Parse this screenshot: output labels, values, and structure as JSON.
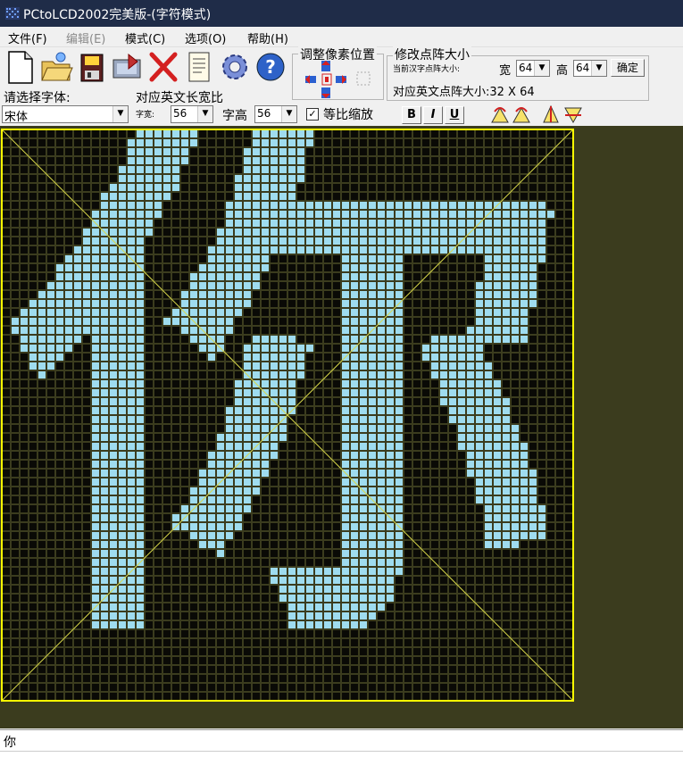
{
  "window": {
    "title": "PCtoLCD2002完美版-(字符模式)"
  },
  "menu": [
    {
      "label": "文件(F)",
      "enabled": true
    },
    {
      "label": "编辑(E)",
      "enabled": false
    },
    {
      "label": "模式(C)",
      "enabled": true
    },
    {
      "label": "选项(O)",
      "enabled": true
    },
    {
      "label": "帮助(H)",
      "enabled": true
    }
  ],
  "toolbar": {
    "icons": [
      "new-file-icon",
      "open-folder-icon",
      "save-disk-icon",
      "export-icon",
      "delete-x-icon",
      "notes-icon",
      "settings-gear-icon",
      "help-icon"
    ]
  },
  "font_panel": {
    "select_label": "请选择字体:",
    "font_value": "宋体",
    "ratio_label": "对应英文长宽比",
    "char_width_label": "字宽:",
    "char_width_value": "56",
    "char_height_label": "字高",
    "char_height_value": "56",
    "scale_label": "等比缩放",
    "scale_checked": true,
    "bold_label": "B",
    "italic_label": "I",
    "underline_label": "U"
  },
  "adjust_panel": {
    "title": "调整像素位置"
  },
  "dot_panel": {
    "title": "修改点阵大小",
    "current_label": "当前汉字点阵大小:",
    "width_label": "宽",
    "width_value": "64",
    "height_label": "高",
    "height_value": "64",
    "confirm_label": "确定",
    "english_size_label": "对应英文点阵大小:32 X 64"
  },
  "matrix": {
    "cols": 64,
    "rows": 64,
    "colors": {
      "background": "#3b3c1e",
      "off_cell": "#0a0a06",
      "on_cell": "#9fdcef",
      "frame": "#ffff00",
      "diagonal": "#d8d84a"
    },
    "glyph_char": "你"
  },
  "input_box": {
    "value": "你"
  }
}
